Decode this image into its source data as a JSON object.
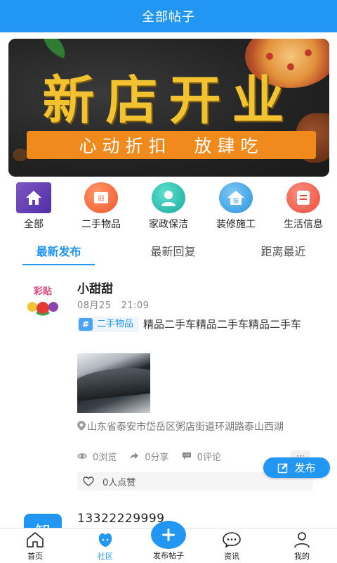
{
  "header": {
    "title": "全部帖子"
  },
  "banner": {
    "headline": "新店开业",
    "slogan": "心动折扣  放肆吃",
    "slide_count": 2,
    "active_slide": 2
  },
  "categories": [
    {
      "label": "全部",
      "icon": "home-icon",
      "color": "#6a3fc0"
    },
    {
      "label": "二手物品",
      "icon": "secondhand-icon",
      "color": "#f26b3a"
    },
    {
      "label": "家政保洁",
      "icon": "housekeeping-icon",
      "color": "#22b8a8"
    },
    {
      "label": "装修施工",
      "icon": "renovation-icon",
      "color": "#3aa6e8"
    },
    {
      "label": "生活信息",
      "icon": "life-info-icon",
      "color": "#f05a4a"
    }
  ],
  "tabs": [
    {
      "label": "最新发布",
      "active": true
    },
    {
      "label": "最新回复",
      "active": false
    },
    {
      "label": "距离最近",
      "active": false
    }
  ],
  "post": {
    "user_name": "小甜甜",
    "time": "08月25   21:09",
    "tag": "二手物品",
    "content": "精品二手车精品二手车精品二手车",
    "location": "山东省泰安市岱岳区粥店街道环湖路泰山西湖",
    "views": "0浏览",
    "shares": "0分享",
    "comments": "0评论",
    "more": "···",
    "likes": "0人点赞",
    "avatar_text": "彩贴"
  },
  "fab": {
    "label": "发布"
  },
  "post2": {
    "user_name": "13322229999",
    "avatar_text": "知"
  },
  "bottom_nav": {
    "items": [
      {
        "label": "首页",
        "icon": "home-icon"
      },
      {
        "label": "社区",
        "icon": "community-icon",
        "active": true
      },
      {
        "label": "发布帖子",
        "icon": "plus-icon"
      },
      {
        "label": "资讯",
        "icon": "chat-icon"
      },
      {
        "label": "我的",
        "icon": "user-icon"
      }
    ]
  },
  "colors": {
    "primary": "#2196f3",
    "banner_accent": "#f08a1c",
    "banner_title": "#f2c230"
  }
}
